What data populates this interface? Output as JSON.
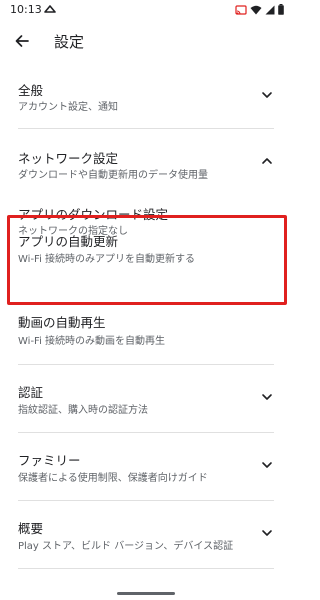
{
  "status_bar": {
    "time": "10:13",
    "left_icon": "cloud-icon",
    "right_icons": [
      "cast-icon",
      "wifi-icon",
      "signal-icon",
      "battery-icon"
    ]
  },
  "app_bar": {
    "back_icon": "arrow-left-icon",
    "title": "設定"
  },
  "sections": [
    {
      "title": "全般",
      "subtitle": "アカウント設定、通知",
      "chevron": "down"
    },
    {
      "title": "ネットワーク設定",
      "subtitle": "ダウンロードや自動更新用のデータ使用量",
      "chevron": "up"
    },
    {
      "title": "アプリのダウンロード設定",
      "subtitle": "ネットワークの指定なし"
    },
    {
      "title": "アプリの自動更新",
      "subtitle": "Wi-Fi 接続時のみアプリを自動更新する",
      "highlighted": true
    },
    {
      "title": "動画の自動再生",
      "subtitle": "Wi-Fi 接続時のみ動画を自動再生"
    },
    {
      "title": "認証",
      "subtitle": "指紋認証、購入時の認証方法",
      "chevron": "down"
    },
    {
      "title": "ファミリー",
      "subtitle": "保護者による使用制限、保護者向けガイド",
      "chevron": "down"
    },
    {
      "title": "概要",
      "subtitle": "Play ストア、ビルド バージョン、デバイス認証",
      "chevron": "down"
    }
  ],
  "colors": {
    "highlight_border": "#e0201f",
    "text_primary": "#202124",
    "text_secondary": "#5f6368",
    "divider": "#e0e0e0"
  }
}
